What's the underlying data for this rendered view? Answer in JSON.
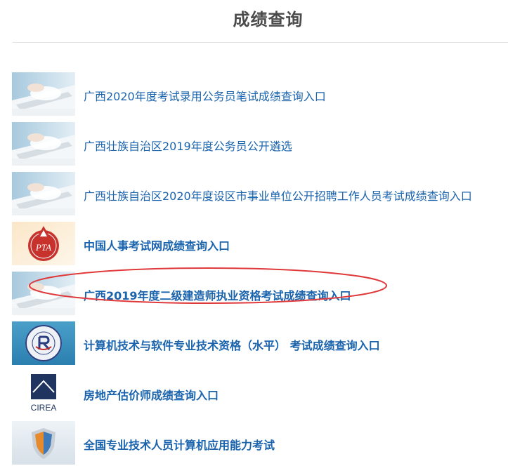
{
  "page": {
    "title": "成绩查询"
  },
  "items": [
    {
      "label": "广西2020年度考试录用公务员笔试成绩查询入口",
      "icon": "laptop-keyboard-thumbnail",
      "bold": false
    },
    {
      "label": "广西壮族自治区2019年度公务员公开遴选",
      "icon": "laptop-keyboard-thumbnail",
      "bold": false
    },
    {
      "label": "广西壮族自治区2020年度设区市事业单位公开招聘工作人员考试成绩查询入口",
      "icon": "laptop-keyboard-thumbnail",
      "bold": false
    },
    {
      "label": "中国人事考试网成绩查询入口",
      "icon": "pta-logo",
      "logo_text": "PTA",
      "bold": true
    },
    {
      "label": "广西2019年度二级建造师执业资格考试成绩查询入口",
      "icon": "laptop-keyboard-thumbnail",
      "bold": true,
      "circled": true
    },
    {
      "label": "计算机技术与软件专业技术资格（水平） 考试成绩查询入口",
      "icon": "ruankao-seal-logo",
      "bold": true
    },
    {
      "label": "房地产估价师成绩查询入口",
      "icon": "cirea-logo",
      "logo_text": "CIREA",
      "bold": true
    },
    {
      "label": "全国专业技术人员计算机应用能力考试",
      "icon": "shield-logo",
      "bold": true
    }
  ],
  "annotation": {
    "color": "#e0393b"
  }
}
